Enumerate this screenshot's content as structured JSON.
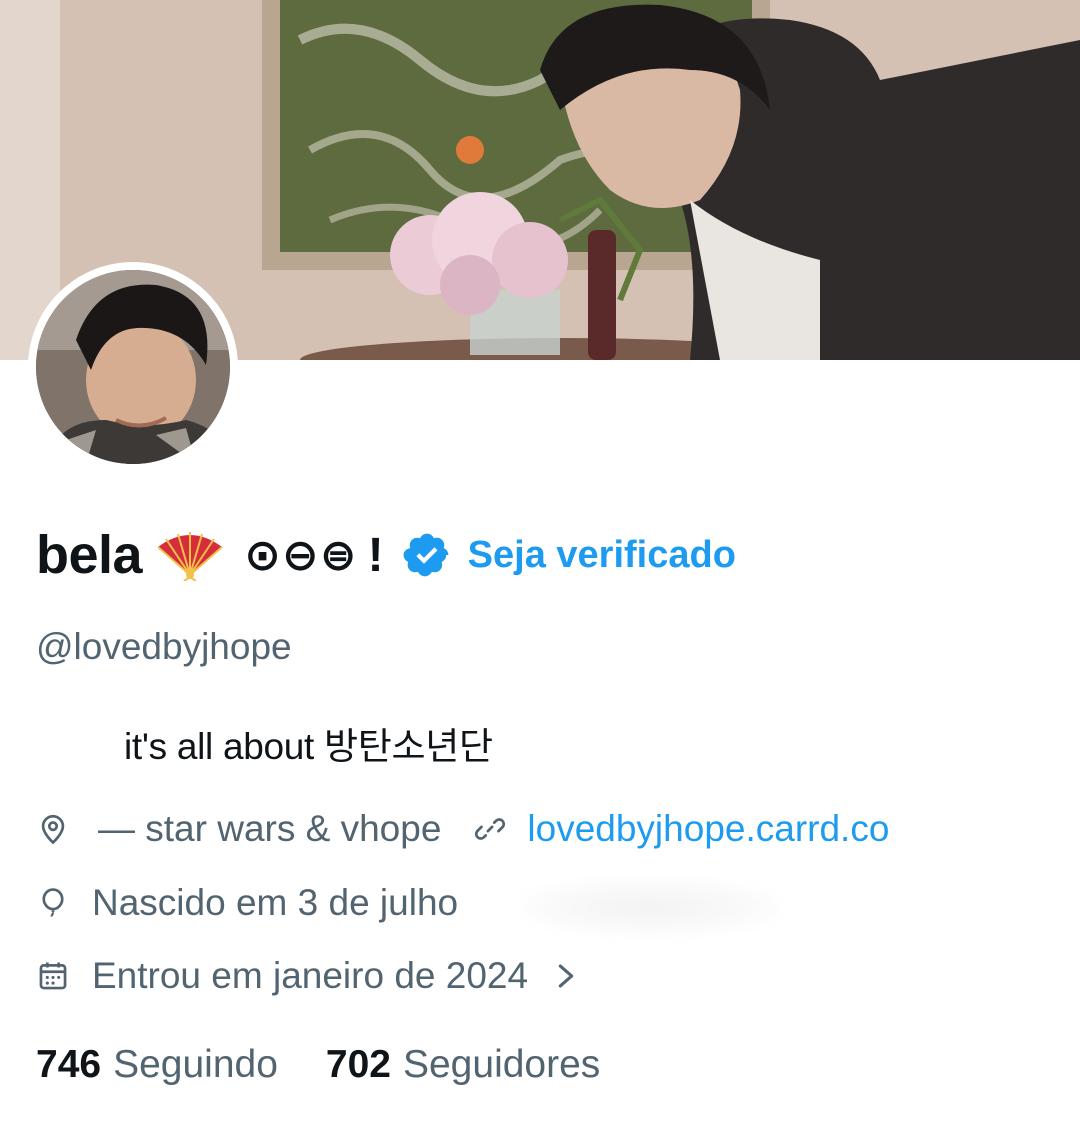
{
  "profile": {
    "display_name": "bela",
    "name_glyphs": "⊙⊖⊜",
    "name_exclaim": "!",
    "get_verified_label": "Seja verificado",
    "handle": "@lovedbyjhope",
    "bio": "it's all about  방탄소년단"
  },
  "meta": {
    "location": "— star wars & vhope",
    "link": "lovedbyjhope.carrd.co",
    "birthday": "Nascido em 3 de julho",
    "joined": "Entrou em janeiro de 2024"
  },
  "counts": {
    "following_num": "746",
    "following_label": "Seguindo",
    "followers_num": "702",
    "followers_label": "Seguidores"
  },
  "icons": {
    "fan": "folding-fan-icon",
    "verified": "verified-badge-icon",
    "location": "location-pin-icon",
    "link": "link-icon",
    "birthday": "balloon-icon",
    "joined": "calendar-icon",
    "chevron": "chevron-right-icon"
  },
  "colors": {
    "accent": "#1d9bf0",
    "text_primary": "#0f1419",
    "text_secondary": "#536471",
    "fan_red": "#d62d3a"
  }
}
